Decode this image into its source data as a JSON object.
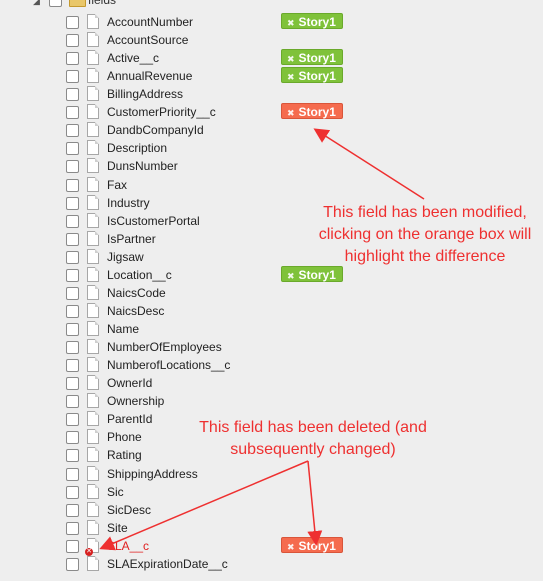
{
  "tree": {
    "folder_label": "fields",
    "rows": [
      {
        "label": "AccountNumber",
        "badge": "Story1",
        "badge_color": "green"
      },
      {
        "label": "AccountSource"
      },
      {
        "label": "Active__c",
        "badge": "Story1",
        "badge_color": "green"
      },
      {
        "label": "AnnualRevenue",
        "badge": "Story1",
        "badge_color": "green"
      },
      {
        "label": "BillingAddress"
      },
      {
        "label": "CustomerPriority__c",
        "badge": "Story1",
        "badge_color": "orange"
      },
      {
        "label": "DandbCompanyId"
      },
      {
        "label": "Description"
      },
      {
        "label": "DunsNumber"
      },
      {
        "label": "Fax"
      },
      {
        "label": "Industry"
      },
      {
        "label": "IsCustomerPortal"
      },
      {
        "label": "IsPartner"
      },
      {
        "label": "Jigsaw"
      },
      {
        "label": "Location__c",
        "badge": "Story1",
        "badge_color": "green"
      },
      {
        "label": "NaicsCode"
      },
      {
        "label": "NaicsDesc"
      },
      {
        "label": "Name"
      },
      {
        "label": "NumberOfEmployees"
      },
      {
        "label": "NumberofLocations__c"
      },
      {
        "label": "OwnerId"
      },
      {
        "label": "Ownership"
      },
      {
        "label": "ParentId"
      },
      {
        "label": "Phone"
      },
      {
        "label": "Rating"
      },
      {
        "label": "ShippingAddress"
      },
      {
        "label": "Sic"
      },
      {
        "label": "SicDesc"
      },
      {
        "label": "Site"
      },
      {
        "label": "SLA__c",
        "badge": "Story1",
        "badge_color": "orange",
        "deleted": true
      },
      {
        "label": "SLAExpirationDate__c"
      }
    ]
  },
  "annotations": {
    "modified_note": "This field has been modified, clicking on the orange box will highlight the difference",
    "deleted_note": "This field has been deleted (and subsequently changed)",
    "arrow_color": "#ee3030"
  },
  "colors": {
    "badge_green": "#7fc23a",
    "badge_orange": "#f56b4e",
    "deleted_text": "#e02020"
  }
}
